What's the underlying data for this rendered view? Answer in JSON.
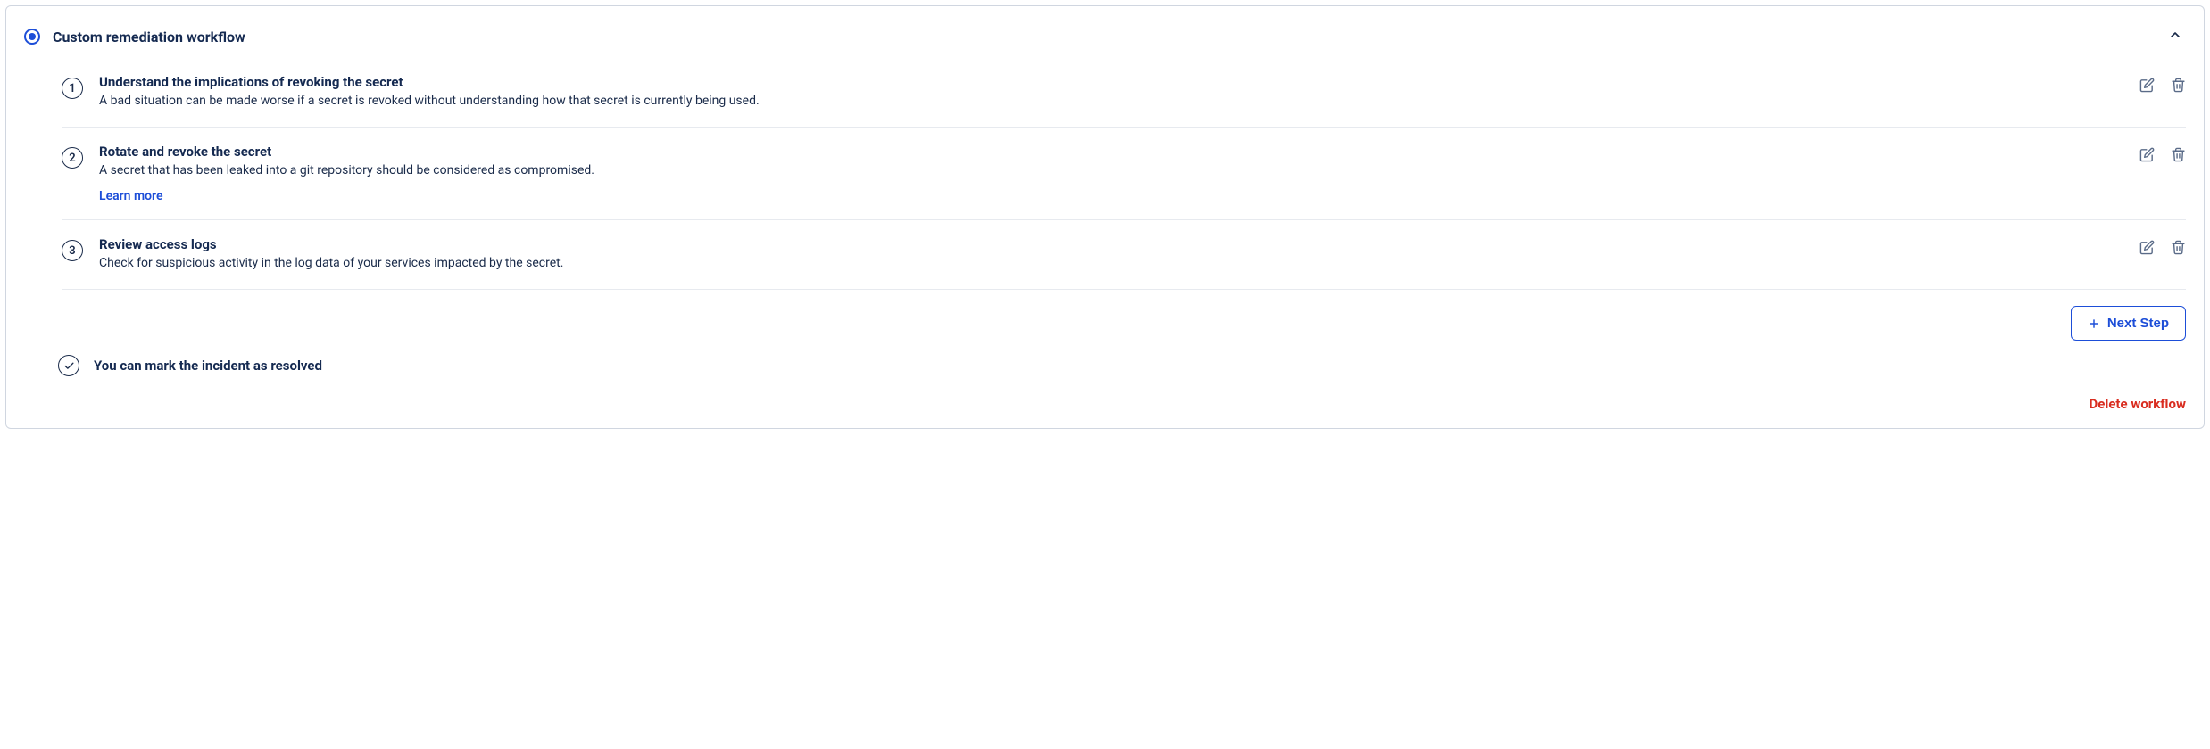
{
  "header": {
    "title": "Custom remediation workflow"
  },
  "steps": [
    {
      "num": "1",
      "title": "Understand the implications of revoking the secret",
      "desc": "A bad situation can be made worse if a secret is revoked without understanding how that secret is currently being used.",
      "link": null
    },
    {
      "num": "2",
      "title": "Rotate and revoke the secret",
      "desc": "A secret that has been leaked into a git repository should be considered as compromised.",
      "link": "Learn more"
    },
    {
      "num": "3",
      "title": "Review access logs",
      "desc": "Check for suspicious activity in the log data of your services impacted by the secret.",
      "link": null
    }
  ],
  "footer": {
    "next_step": "Next Step",
    "resolved_text": "You can mark the incident as resolved",
    "delete": "Delete workflow"
  }
}
